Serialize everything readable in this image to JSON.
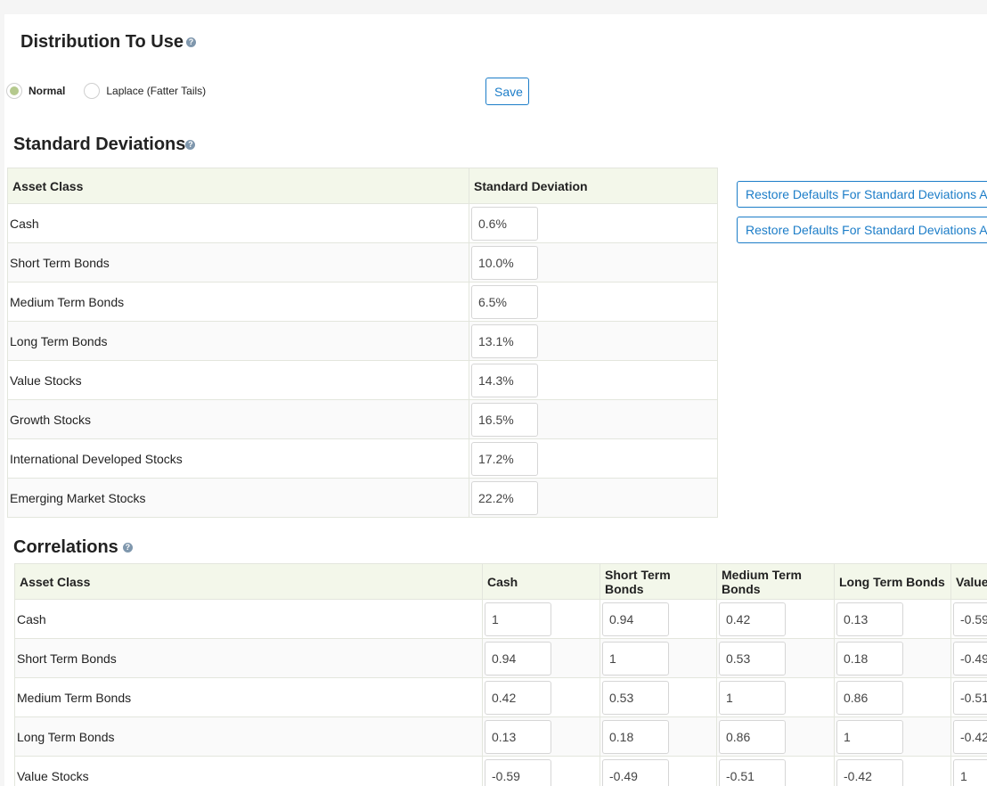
{
  "distribution": {
    "title": "Distribution To Use",
    "help": "?",
    "options": [
      {
        "label": "Normal",
        "checked": true
      },
      {
        "label": "Laplace (Fatter Tails)",
        "checked": false
      }
    ],
    "save_label": "Save"
  },
  "std_dev": {
    "title": "Standard Deviations",
    "help": "?",
    "headers": [
      "Asset Class",
      "Standard Deviation"
    ],
    "rows": [
      {
        "asset": "Cash",
        "value": "0.6%"
      },
      {
        "asset": "Short Term Bonds",
        "value": "10.0%"
      },
      {
        "asset": "Medium Term Bonds",
        "value": "6.5%"
      },
      {
        "asset": "Long Term Bonds",
        "value": "13.1%"
      },
      {
        "asset": "Value Stocks",
        "value": "14.3%"
      },
      {
        "asset": "Growth Stocks",
        "value": "16.5%"
      },
      {
        "asset": "International Developed Stocks",
        "value": "17.2%"
      },
      {
        "asset": "Emerging Market Stocks",
        "value": "22.2%"
      }
    ],
    "restore_buttons": [
      "Restore Defaults For Standard Deviations A",
      "Restore Defaults For Standard Deviations A"
    ]
  },
  "correlations": {
    "title": "Correlations",
    "help": "?",
    "headers": [
      "Asset Class",
      "Cash",
      "Short Term Bonds",
      "Medium Term Bonds",
      "Long Term Bonds",
      "Value"
    ],
    "rows": [
      {
        "asset": "Cash",
        "values": [
          "1",
          "0.94",
          "0.42",
          "0.13",
          "-0.59"
        ]
      },
      {
        "asset": "Short Term Bonds",
        "values": [
          "0.94",
          "1",
          "0.53",
          "0.18",
          "-0.49"
        ]
      },
      {
        "asset": "Medium Term Bonds",
        "values": [
          "0.42",
          "0.53",
          "1",
          "0.86",
          "-0.51"
        ]
      },
      {
        "asset": "Long Term Bonds",
        "values": [
          "0.13",
          "0.18",
          "0.86",
          "1",
          "-0.42"
        ]
      },
      {
        "asset": "Value Stocks",
        "values": [
          "-0.59",
          "-0.49",
          "-0.51",
          "-0.42",
          "1"
        ]
      }
    ]
  }
}
